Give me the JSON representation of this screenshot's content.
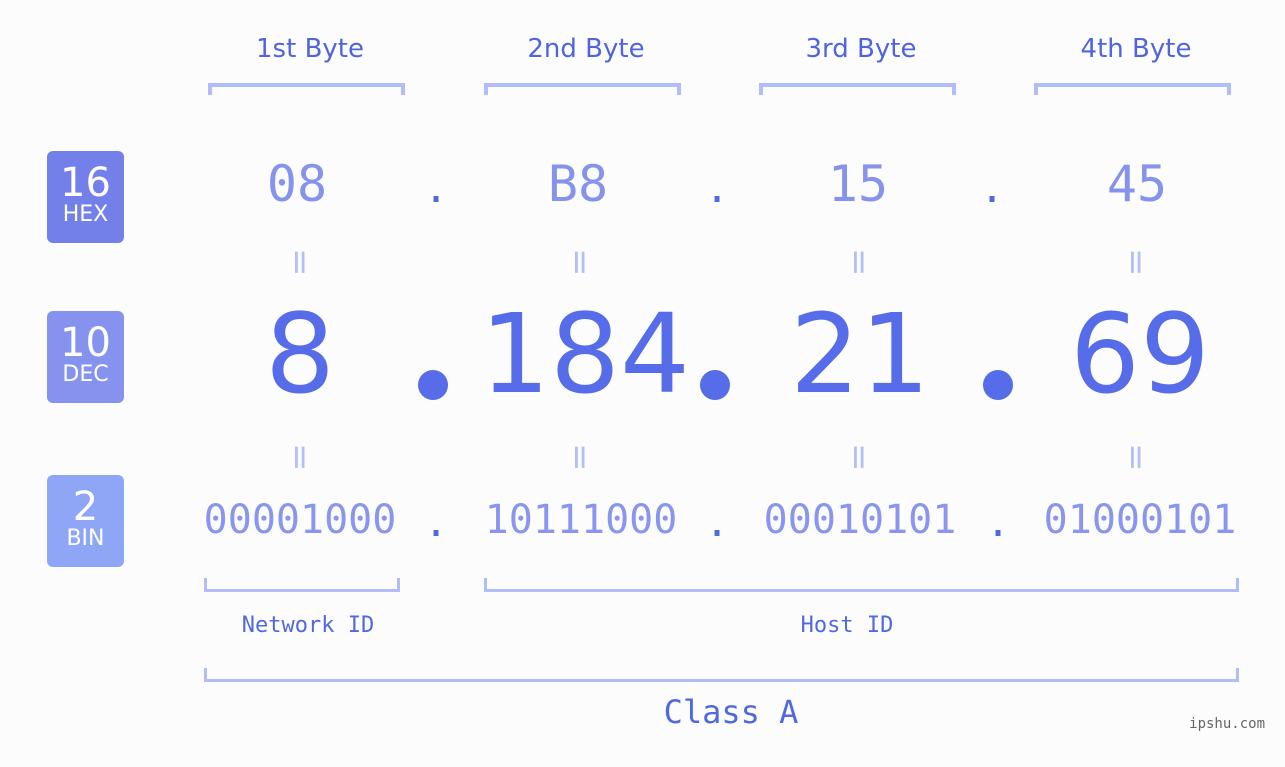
{
  "bytes": {
    "headers": [
      "1st Byte",
      "2nd Byte",
      "3rd Byte",
      "4th Byte"
    ]
  },
  "rows": {
    "hex": {
      "base": "16",
      "label": "HEX",
      "values": [
        "08",
        "B8",
        "15",
        "45"
      ]
    },
    "dec": {
      "base": "10",
      "label": "DEC",
      "values": [
        "8",
        "184",
        "21",
        "69"
      ]
    },
    "bin": {
      "base": "2",
      "label": "BIN",
      "values": [
        "00001000",
        "10111000",
        "00010101",
        "01000101"
      ]
    }
  },
  "separator": ".",
  "equals": "=",
  "segments": {
    "network": "Network ID",
    "host": "Host ID"
  },
  "ip_class": "Class A",
  "watermark": "ipshu.com",
  "colors": {
    "hex_badge": "#7380e9",
    "dec_badge": "#8593ef",
    "bin_badge": "#8fa6f6",
    "accent": "#566ce8",
    "bracket": "#b2bcf8"
  }
}
